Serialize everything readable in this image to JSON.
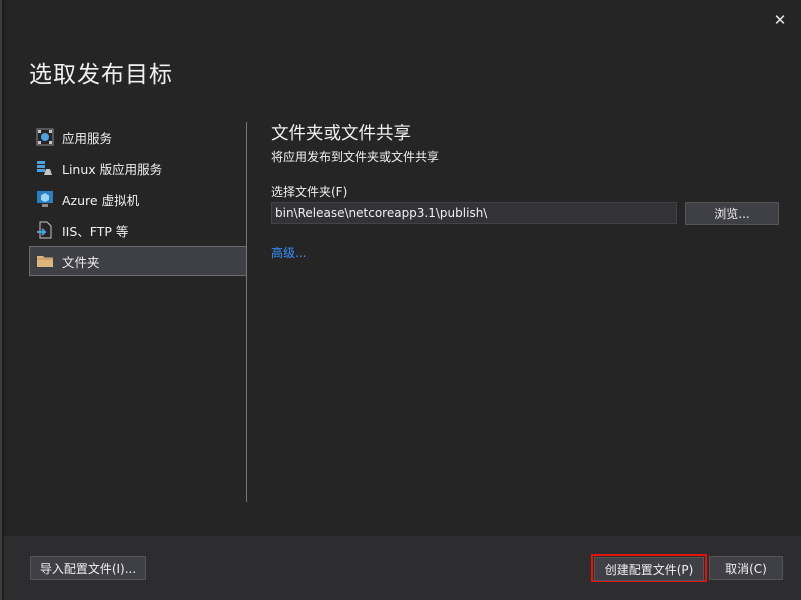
{
  "dialog": {
    "title": "选取发布目标",
    "close_label": "✕"
  },
  "nav": {
    "items": [
      {
        "label": "应用服务",
        "icon": "app-service-icon",
        "selected": false
      },
      {
        "label": "Linux 版应用服务",
        "icon": "linux-app-service-icon",
        "selected": false
      },
      {
        "label": "Azure 虚拟机",
        "icon": "azure-vm-icon",
        "selected": false
      },
      {
        "label": "IIS、FTP 等",
        "icon": "iis-ftp-icon",
        "selected": false
      },
      {
        "label": "文件夹",
        "icon": "folder-icon",
        "selected": true
      }
    ]
  },
  "content": {
    "title": "文件夹或文件共享",
    "subtitle": "将应用发布到文件夹或文件共享",
    "folder_label": "选择文件夹(F)",
    "folder_value": "bin\\Release\\netcoreapp3.1\\publish\\",
    "browse_label": "浏览...",
    "advanced_label": "高级..."
  },
  "footer": {
    "import_label": "导入配置文件(I)...",
    "create_label": "创建配置文件(P)",
    "cancel_label": "取消(C)"
  },
  "colors": {
    "background": "#252526",
    "footer": "#2d2d30",
    "link": "#3794ff",
    "highlight_border": "#e51400"
  }
}
